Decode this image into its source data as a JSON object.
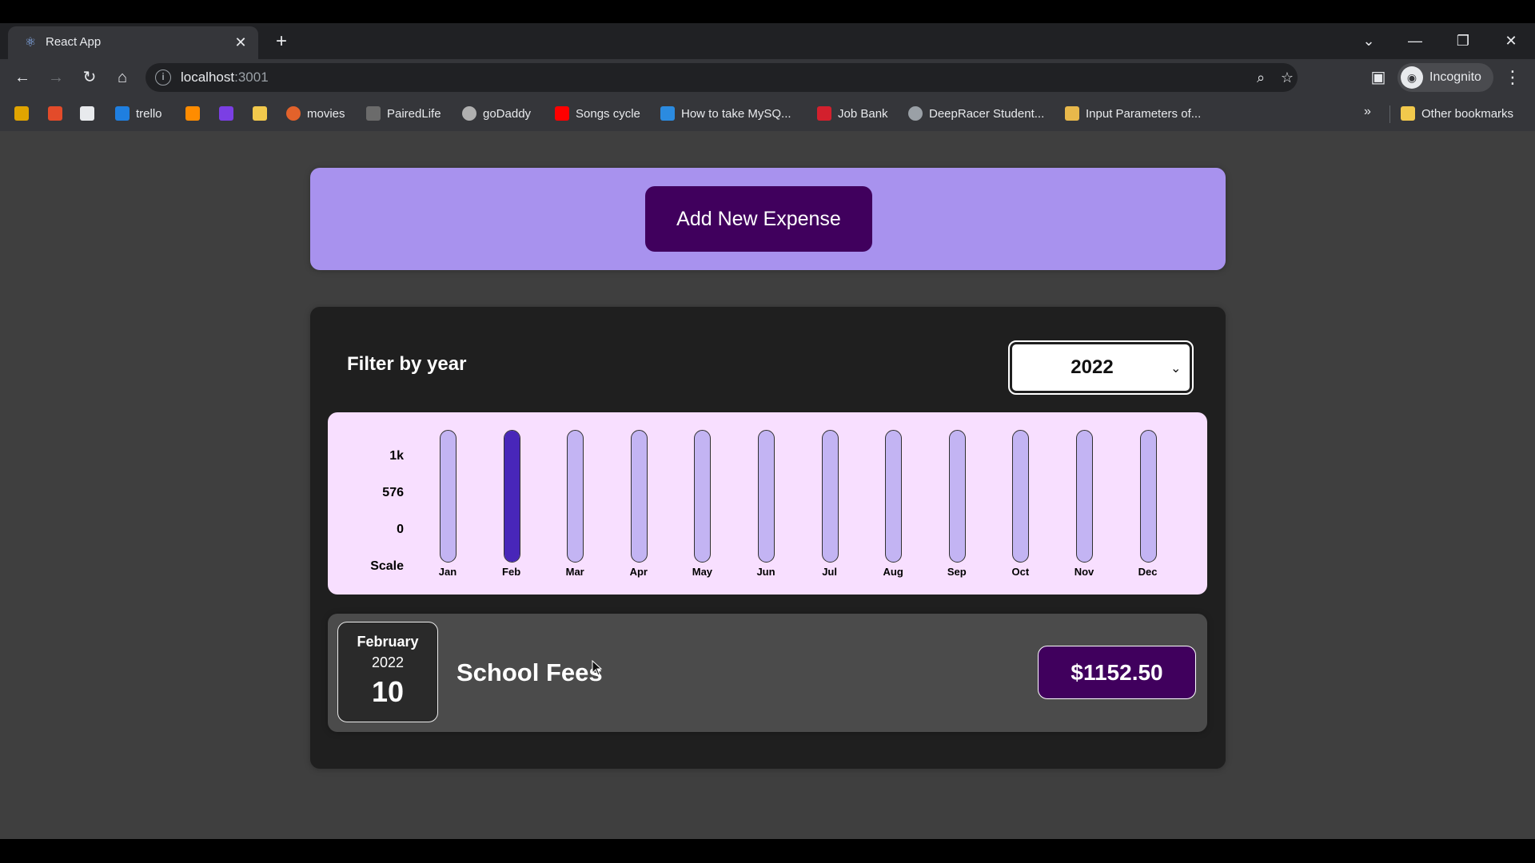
{
  "browser": {
    "tab_title": "React App",
    "url_host": "localhost",
    "url_port": ":3001",
    "profile_label": "Incognito",
    "bookmarks": [
      {
        "label": "",
        "color": "#e0a400"
      },
      {
        "label": "",
        "color": "#e34b2a"
      },
      {
        "label": "",
        "color": "#3b3b3b"
      },
      {
        "label": "trello",
        "color": "#1f7fe0"
      },
      {
        "label": "",
        "color": "#ff8c00"
      },
      {
        "label": "",
        "color": "#7b3fe4"
      },
      {
        "label": "",
        "color": "#f2c94c"
      },
      {
        "label": "movies",
        "color": "#e2622b"
      },
      {
        "label": "PairedLife",
        "color": "#3b3b3b"
      },
      {
        "label": "goDaddy",
        "color": "#b0b0b0"
      },
      {
        "label": "Songs cycle",
        "color": "#ff0000"
      },
      {
        "label": "How to take MySQ...",
        "color": "#2b8be0"
      },
      {
        "label": "Job Bank",
        "color": "#d3202d"
      },
      {
        "label": "DeepRacer Student...",
        "color": "#9aa0a6"
      },
      {
        "label": "Input Parameters of...",
        "color": "#e8b84b"
      }
    ],
    "bookmarks_more": "»",
    "other_bookmarks": "Other bookmarks"
  },
  "app": {
    "add_button_label": "Add New Expense",
    "filter_label": "Filter by year",
    "selected_year": "2022",
    "accent_color": "#40005d",
    "chart_fill_color": "#4826b9",
    "scale_labels": [
      "1k",
      "576",
      "0",
      "Scale"
    ]
  },
  "chart_data": {
    "type": "bar",
    "categories": [
      "Jan",
      "Feb",
      "Mar",
      "Apr",
      "May",
      "Jun",
      "Jul",
      "Aug",
      "Sep",
      "Oct",
      "Nov",
      "Dec"
    ],
    "values": [
      0,
      1152.5,
      0,
      0,
      0,
      0,
      0,
      0,
      0,
      0,
      0,
      0
    ],
    "max": 1152.5
  },
  "expense": {
    "month": "February",
    "year": "2022",
    "day": "10",
    "title": "School Fees",
    "price": "$1152.50"
  }
}
